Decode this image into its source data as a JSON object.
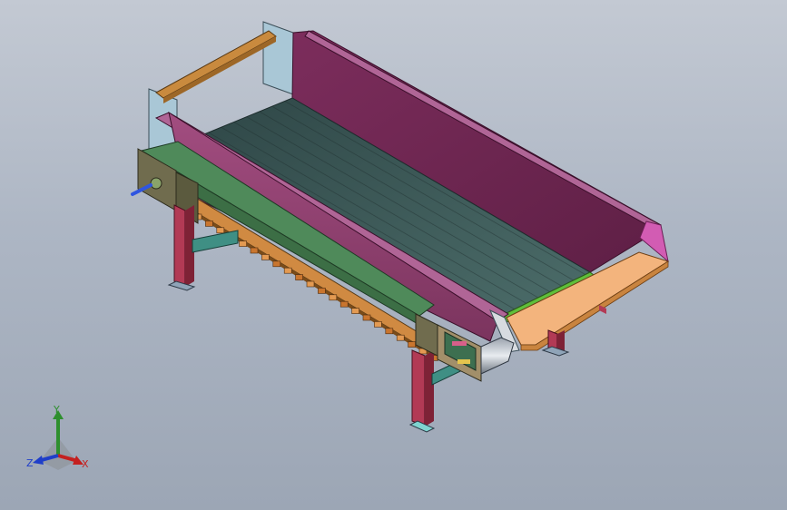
{
  "triad": {
    "x_label": "X",
    "y_label": "Y",
    "z_label": "Z",
    "x_color": "#c42020",
    "y_color": "#2e8f2e",
    "z_color": "#1f3ec9"
  },
  "colors": {
    "background_top": "#c3c9d3",
    "background_bottom": "#9ca6b5",
    "hopper": "#8a3f6b",
    "frame": "#4f8a5a",
    "belt": "#3e5a5a",
    "legs": "#b23a55",
    "rail": "#c98a3e",
    "end_plate": "#f0b07a"
  },
  "icons": [
    "conveyor-model",
    "axis-triad-icon"
  ]
}
